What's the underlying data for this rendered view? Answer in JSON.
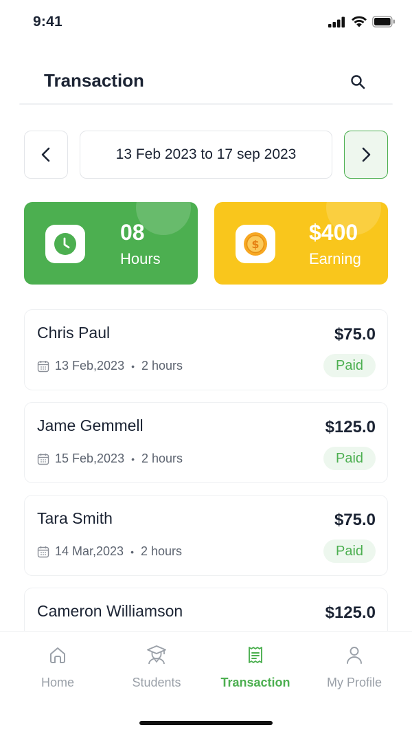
{
  "status_bar": {
    "time": "9:41"
  },
  "header": {
    "title": "Transaction"
  },
  "date_range": {
    "text": "13 Feb 2023 to 17 sep 2023"
  },
  "stats": {
    "hours": {
      "value": "08",
      "label": "Hours",
      "color": "#4caf50"
    },
    "earning": {
      "value": "$400",
      "label": "Earning",
      "color": "#f9c61c"
    }
  },
  "transactions": [
    {
      "name": "Chris Paul",
      "amount": "$75.0",
      "date": "13 Feb,2023",
      "separator": "•",
      "duration": "2 hours",
      "status": "Paid"
    },
    {
      "name": "Jame Gemmell",
      "amount": "$125.0",
      "date": "15 Feb,2023",
      "separator": "•",
      "duration": "2 hours",
      "status": "Paid"
    },
    {
      "name": "Tara Smith",
      "amount": "$75.0",
      "date": "14 Mar,2023",
      "separator": "•",
      "duration": "2 hours",
      "status": "Paid"
    },
    {
      "name": "Cameron Williamson",
      "amount": "$125.0"
    }
  ],
  "bottom_nav": {
    "items": [
      {
        "label": "Home",
        "icon": "home-icon",
        "active": false
      },
      {
        "label": "Students",
        "icon": "student-icon",
        "active": false
      },
      {
        "label": "Transaction",
        "icon": "receipt-icon",
        "active": true
      },
      {
        "label": "My Profile",
        "icon": "user-icon",
        "active": false
      }
    ]
  },
  "colors": {
    "accent": "#4caf50",
    "earning": "#f9c61c",
    "text": "#1b2333",
    "inactive": "#9aa0a8"
  }
}
